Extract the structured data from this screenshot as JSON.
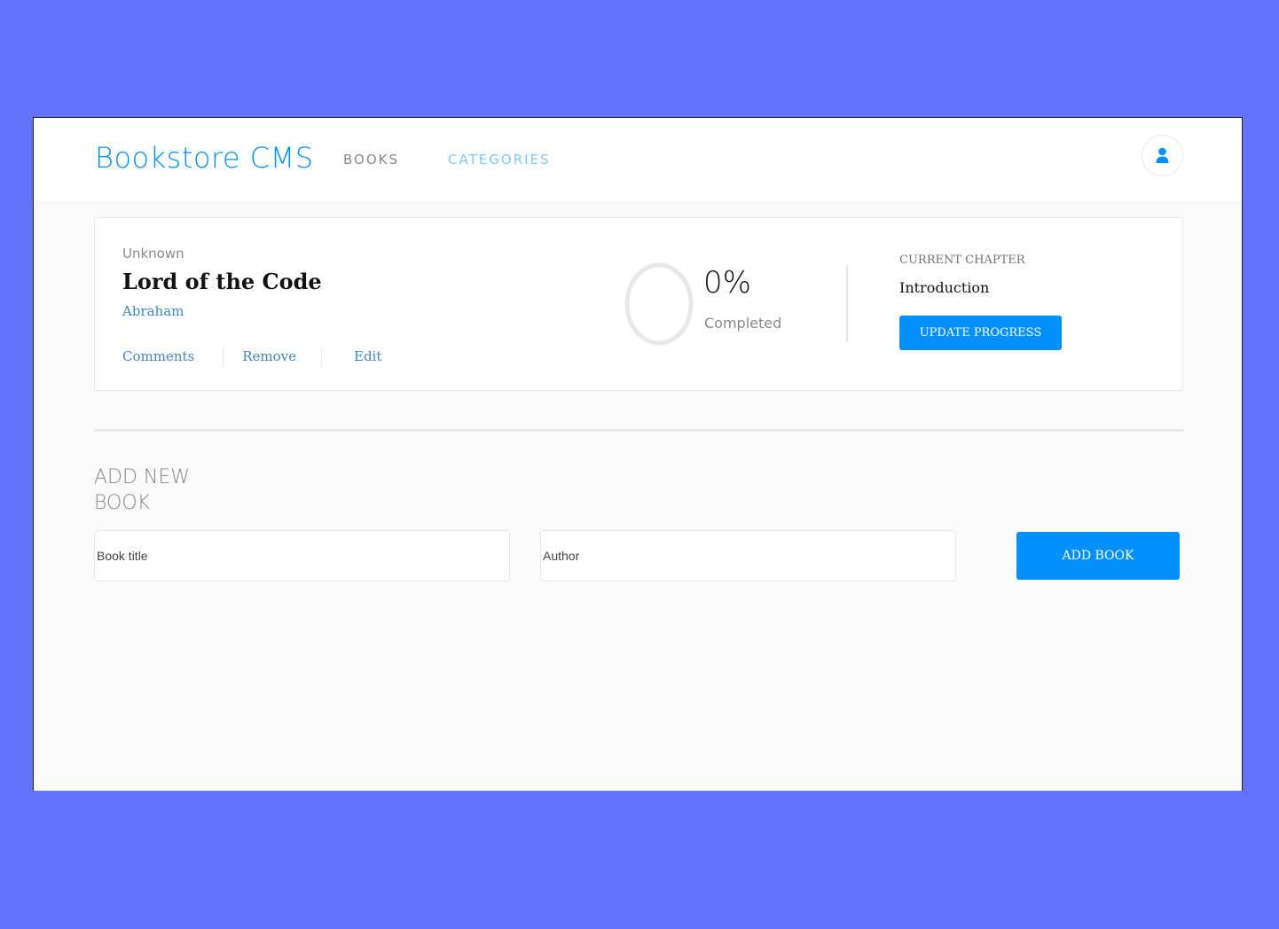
{
  "header": {
    "brand": "Bookstore CMS",
    "nav": {
      "books": "BOOKS",
      "categories": "CATEGORIES"
    },
    "profile_icon": "user-icon"
  },
  "book": {
    "genre": "Unknown",
    "title": "Lord of the Code",
    "author": "Abraham",
    "actions": {
      "comments": "Comments",
      "remove": "Remove",
      "edit": "Edit"
    },
    "progress": {
      "percent": 0,
      "percent_label": "0%",
      "completed_label": "Completed"
    },
    "chapter": {
      "label": "CURRENT CHAPTER",
      "name": "Introduction",
      "update_button": "UPDATE PROGRESS"
    }
  },
  "form": {
    "title": "ADD NEW BOOK",
    "title_placeholder": "Book title",
    "author_placeholder": "Author",
    "add_button": "ADD BOOK"
  },
  "colors": {
    "background": "#6373fe",
    "accent": "#0290ff",
    "link": "#4386bf",
    "panel": "#fafafa"
  }
}
